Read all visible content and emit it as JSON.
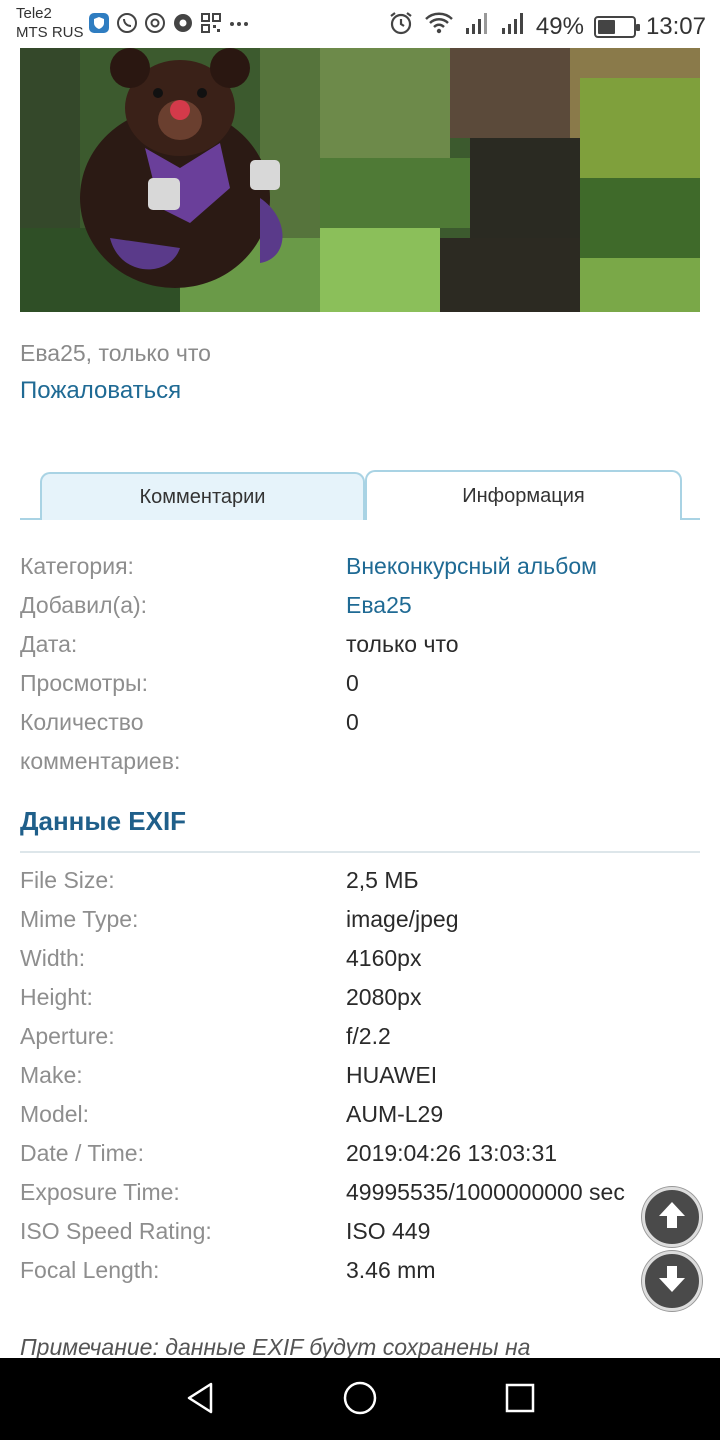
{
  "status_bar": {
    "carrier1": "Tele2",
    "carrier2": "MTS RUS",
    "battery": "49%",
    "battery_level": 0.49,
    "time": "13:07",
    "left_icons": [
      "shield-app-icon",
      "whatsapp-icon",
      "at-icon",
      "record-icon",
      "qr-icon",
      "more-icon"
    ],
    "right_icons": [
      "alarm-icon",
      "wifi-icon",
      "signal-icon",
      "signal-icon"
    ]
  },
  "photo": {
    "subject": "teddy-bear-photo"
  },
  "post": {
    "author_time": "Ева25, только что",
    "report_label": "Пожаловаться"
  },
  "tabs": {
    "comments": "Комментарии",
    "info": "Информация"
  },
  "info": [
    {
      "k": "Категория:",
      "v": "Внеконкурсный альбом",
      "link": true
    },
    {
      "k": "Добавил(а):",
      "v": "Ева25",
      "link": true
    },
    {
      "k": "Дата:",
      "v": "только что",
      "link": false
    },
    {
      "k": "Просмотры:",
      "v": "0",
      "link": false
    },
    {
      "k": "Количество",
      "v": "0",
      "link": false
    },
    {
      "k": "комментариев:",
      "v": "",
      "link": false
    }
  ],
  "exif": {
    "title": "Данные EXIF",
    "rows": [
      {
        "k": "File Size:",
        "v": "2,5 МБ"
      },
      {
        "k": "Mime Type:",
        "v": "image/jpeg"
      },
      {
        "k": "Width:",
        "v": "4160px"
      },
      {
        "k": "Height:",
        "v": "2080px"
      },
      {
        "k": "Aperture:",
        "v": "f/2.2"
      },
      {
        "k": "Make:",
        "v": "HUAWEI"
      },
      {
        "k": "Model:",
        "v": "AUM-L29"
      },
      {
        "k": "Date / Time:",
        "v": "2019:04:26 13:03:31"
      },
      {
        "k": "Exposure Time:",
        "v": "49995535/1000000000 sec"
      },
      {
        "k": "ISO Speed Rating:",
        "v": "ISO 449"
      },
      {
        "k": "Focal Length:",
        "v": "3.46 mm"
      }
    ]
  },
  "note": "Примечание: данные EXIF будут сохранены на",
  "colors": {
    "link": "#1f6a94",
    "heading": "#1f5f8a",
    "tab_border": "#a9d3e4",
    "tab_inactive_bg": "#e6f3fa"
  }
}
